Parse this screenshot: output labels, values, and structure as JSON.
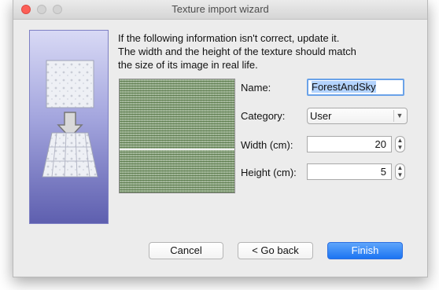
{
  "window": {
    "title": "Texture import wizard"
  },
  "instruction": "If the following information isn't correct, update it.\nThe width and the height of the texture should match\nthe size of its image in real life.",
  "form": {
    "name_label": "Name:",
    "name_value": "ForestAndSky",
    "category_label": "Category:",
    "category_value": "User",
    "width_label": "Width (cm):",
    "width_value": "20",
    "height_label": "Height (cm):",
    "height_value": "5"
  },
  "buttons": {
    "cancel": "Cancel",
    "back": "< Go back",
    "finish": "Finish"
  },
  "colors": {
    "accent": "#1b74f2",
    "selection": "#b3d3fd",
    "side_panel_top": "#d8d9f5",
    "side_panel_bottom": "#5e5faf"
  }
}
